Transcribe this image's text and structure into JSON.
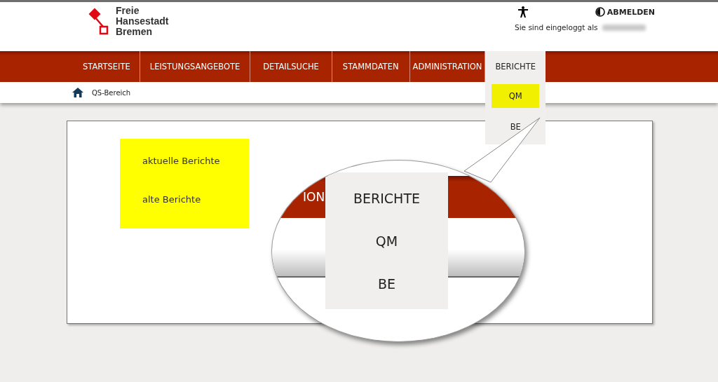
{
  "header": {
    "logo_lines": [
      "Freie",
      "Hansestadt",
      "Bremen"
    ],
    "logout": "ABMELDEN",
    "login_info": "Sie sind eingeloggt als"
  },
  "nav": [
    {
      "label": "STARTSEITE",
      "selected": false
    },
    {
      "label": "LEISTUNGSANGEBOTE",
      "selected": false
    },
    {
      "label": "DETAILSUCHE",
      "selected": false
    },
    {
      "label": "STAMMDATEN",
      "selected": false
    },
    {
      "label": "ADMINISTRATION",
      "selected": false
    },
    {
      "label": "BERICHTE",
      "selected": true
    }
  ],
  "dropdown": [
    {
      "label": "QM",
      "selected": true
    },
    {
      "label": "BE",
      "selected": false
    }
  ],
  "breadcrumb": "QS-Bereich",
  "report_links": [
    "aktuelle Berichte",
    "alte Berichte"
  ],
  "magnifier": {
    "nav_fragment": "ION",
    "title": "BERICHTE",
    "items": [
      "QM",
      "BE"
    ]
  }
}
